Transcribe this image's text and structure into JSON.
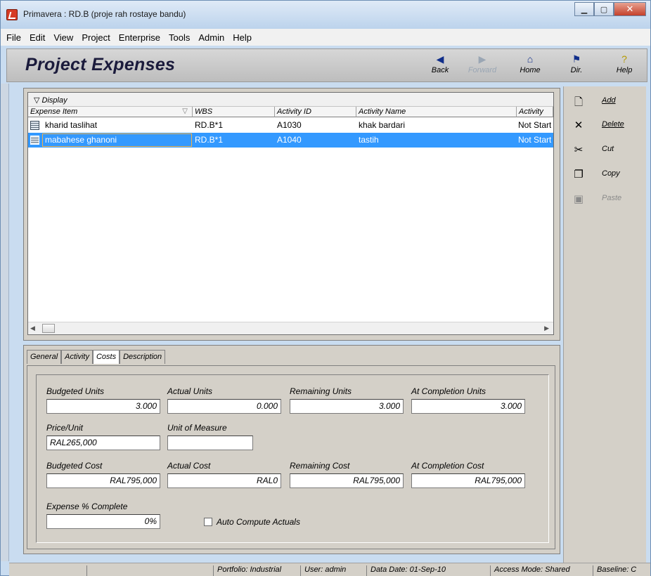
{
  "window": {
    "title": "Primavera : RD.B (proje rah rostaye bandu)"
  },
  "menu": [
    "File",
    "Edit",
    "View",
    "Project",
    "Enterprise",
    "Tools",
    "Admin",
    "Help"
  ],
  "header": {
    "title": "Project Expenses",
    "nav": {
      "back": "Back",
      "forward": "Forward",
      "home": "Home",
      "dir": "Dir.",
      "help": "Help"
    }
  },
  "grid": {
    "display_label": "Display",
    "columns": [
      "Expense Item",
      "WBS",
      "Activity ID",
      "Activity Name",
      "Activity"
    ],
    "rows": [
      {
        "item": "kharid taslihat",
        "wbs": "RD.B*1",
        "activity_id": "A1030",
        "activity_name": "khak bardari",
        "status": "Not Started"
      },
      {
        "item": "mabahese ghanoni",
        "wbs": "RD.B*1",
        "activity_id": "A1040",
        "activity_name": "tastih",
        "status": "Not Started"
      }
    ]
  },
  "sidebar": {
    "add": "Add",
    "delete": "Delete",
    "cut": "Cut",
    "copy": "Copy",
    "paste": "Paste"
  },
  "tabs": [
    "General",
    "Activity",
    "Costs",
    "Description"
  ],
  "active_tab": "Costs",
  "costs": {
    "budgeted_units_label": "Budgeted Units",
    "budgeted_units": "3.000",
    "actual_units_label": "Actual Units",
    "actual_units": "0.000",
    "remaining_units_label": "Remaining Units",
    "remaining_units": "3.000",
    "at_completion_units_label": "At Completion Units",
    "at_completion_units": "3.000",
    "price_unit_label": "Price/Unit",
    "price_unit": "RAL265,000",
    "uom_label": "Unit of Measure",
    "uom": "",
    "budgeted_cost_label": "Budgeted Cost",
    "budgeted_cost": "RAL795,000",
    "actual_cost_label": "Actual Cost",
    "actual_cost": "RAL0",
    "remaining_cost_label": "Remaining Cost",
    "remaining_cost": "RAL795,000",
    "at_completion_cost_label": "At Completion Cost",
    "at_completion_cost": "RAL795,000",
    "expense_pct_label": "Expense % Complete",
    "expense_pct": "0%",
    "auto_compute_label": "Auto Compute Actuals"
  },
  "status": {
    "portfolio": "Portfolio: Industrial",
    "user": "User: admin",
    "data_date": "Data Date: 01-Sep-10",
    "access_mode": "Access Mode: Shared",
    "baseline": "Baseline: C"
  }
}
